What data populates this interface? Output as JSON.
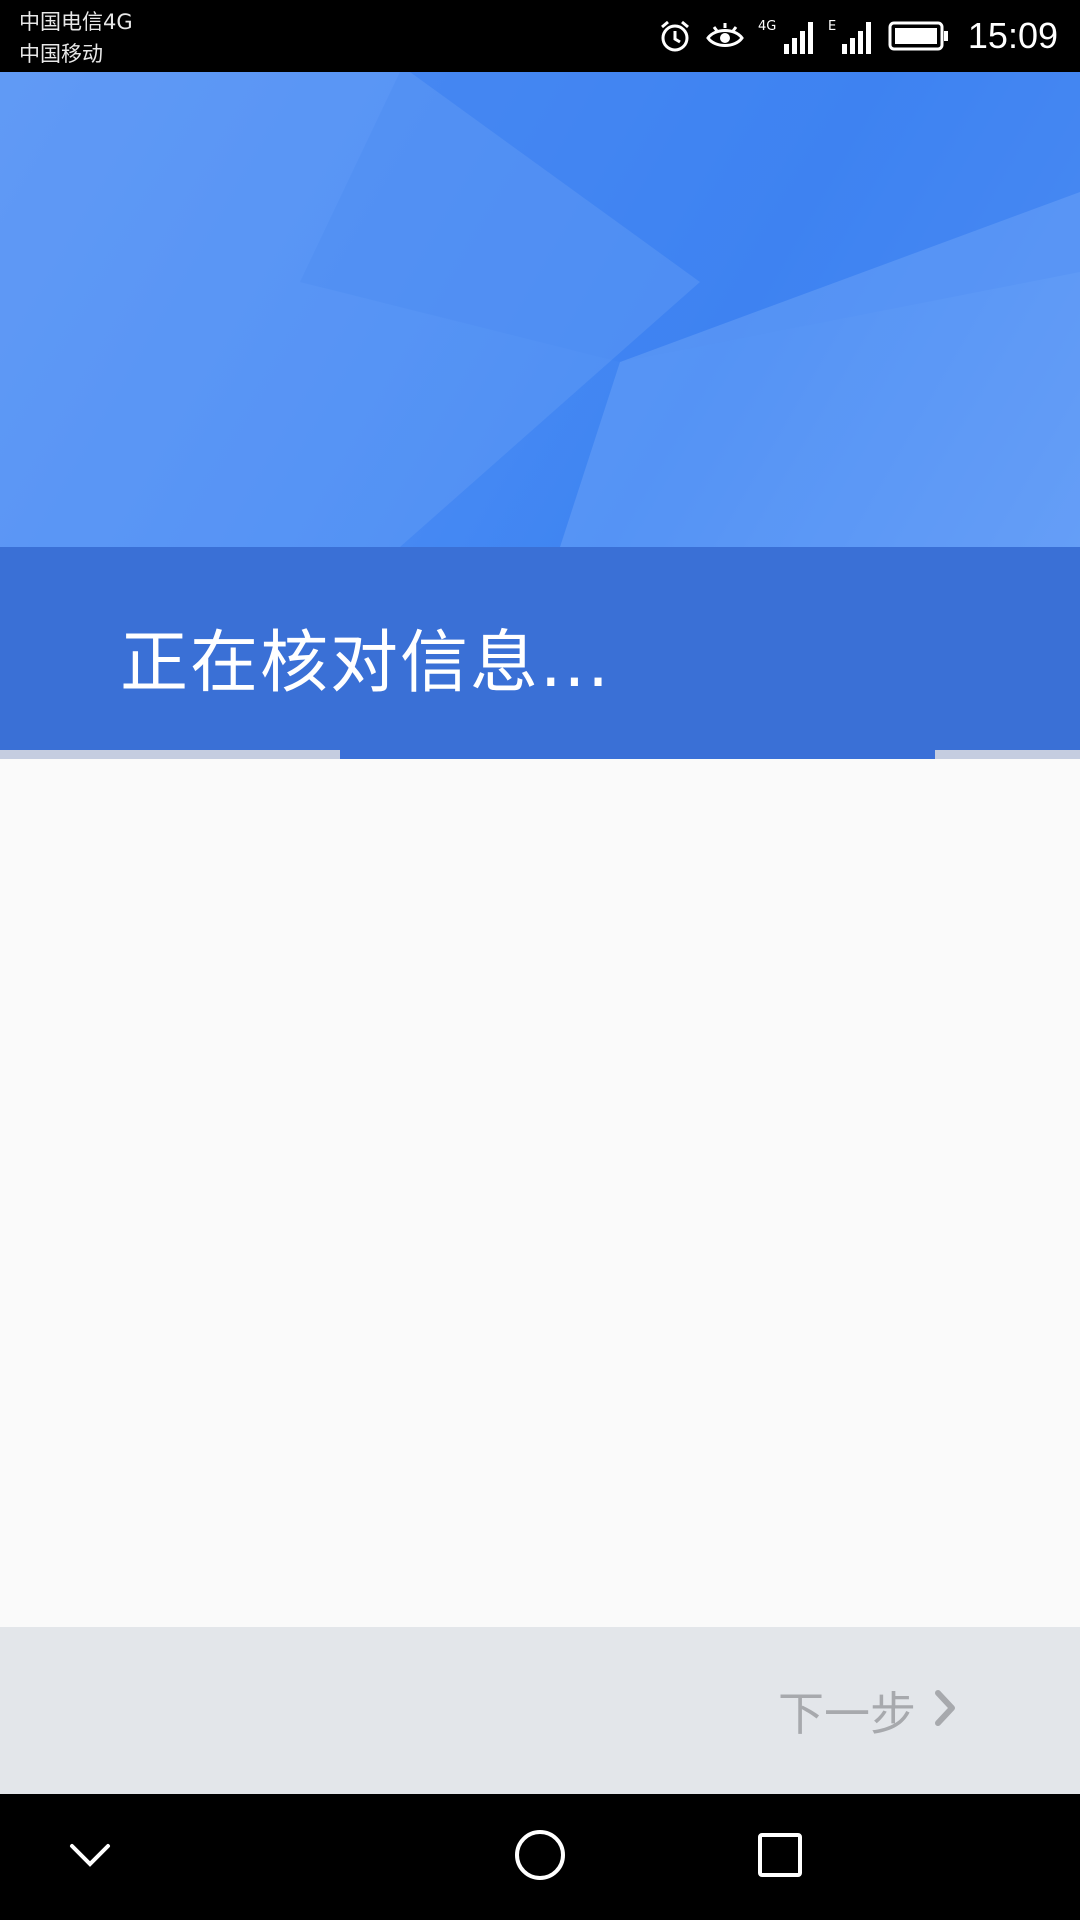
{
  "status_bar": {
    "carrier_1": "中国电信4G",
    "carrier_2": "中国移动",
    "time": "15:09",
    "icons": [
      "alarm-icon",
      "eye-comfort-icon",
      "signal-4g-icon",
      "signal-e-icon",
      "battery-icon"
    ]
  },
  "header": {
    "title": "正在核对信息...",
    "progress": 0.55
  },
  "footer": {
    "next_label": "下一步"
  },
  "nav": {
    "icons": [
      "back-chevron-icon",
      "home-circle-icon",
      "recents-square-icon"
    ]
  },
  "colors": {
    "accent": "#3a70d6",
    "hero_blue": "#4b8cf4",
    "footer_bg": "#e3e6ea",
    "disabled_text": "#a7a9ad"
  }
}
